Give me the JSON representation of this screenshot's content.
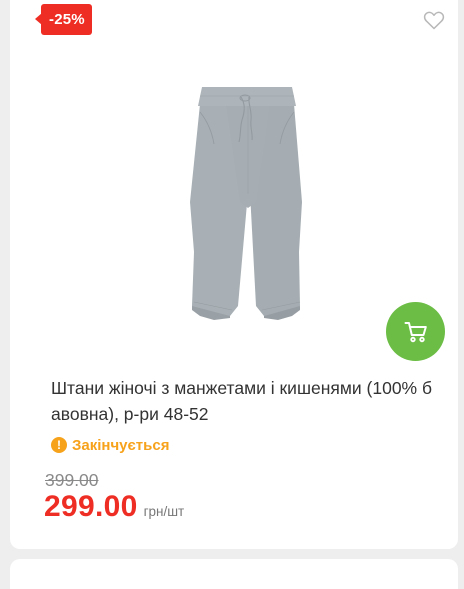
{
  "product": {
    "discount_badge": "-25%",
    "title": "Штани жіночі з манжетами і кишенями (100% бавовна), р-ри 48-52",
    "status": "Закінчується",
    "old_price": "399.00",
    "price": "299.00",
    "unit": "грн/шт"
  },
  "icons": {
    "wishlist": "heart-outline-icon",
    "cart": "shopping-cart-icon",
    "status": "exclamation-circle-icon"
  },
  "colors": {
    "badge": "#ee2e24",
    "price": "#ee2e24",
    "cart_button": "#6cbd45",
    "status": "#f7a21b"
  }
}
